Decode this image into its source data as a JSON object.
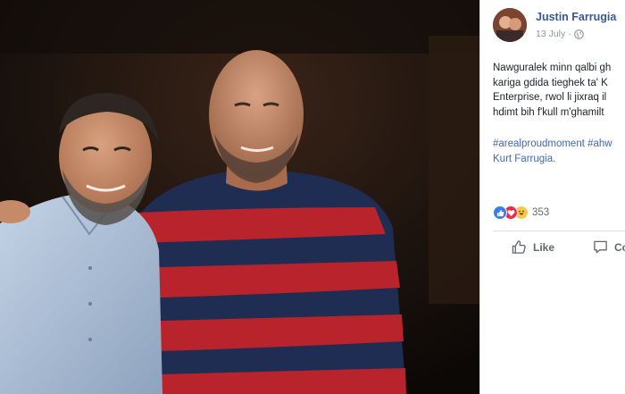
{
  "post": {
    "author": "Justin Farrugia",
    "date": "13 July",
    "date_separator": "·",
    "privacy_icon": "globe-icon",
    "text_lines": [
      "Nawguralek minn qalbi gh",
      "kariga gdida tieghek ta' K",
      "Enterprise, rwol li jixraq il",
      "hdimt bih f'kull m'ghamilt"
    ],
    "hashtag_lines": [
      "#arealproudmoment #ahw",
      "Kurt Farrugia."
    ]
  },
  "reactions": {
    "icons": [
      "like-reaction-icon",
      "love-reaction-icon",
      "haha-reaction-icon"
    ],
    "count": "353"
  },
  "actions": {
    "like_label": "Like",
    "comment_label": "Co"
  },
  "colors": {
    "author_link": "#385898",
    "hashtag": "#4267b2",
    "secondary_text": "#90949c",
    "like_blue": "#3b7de8",
    "love_red": "#f0284a",
    "haha_yellow": "#f7c948"
  }
}
